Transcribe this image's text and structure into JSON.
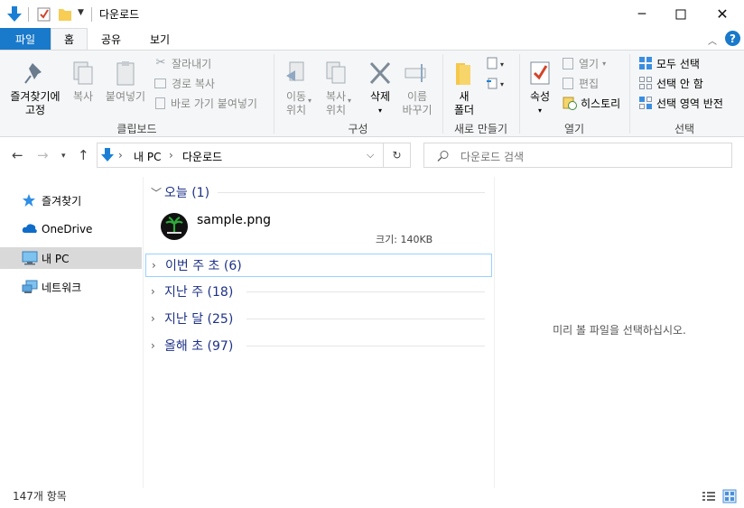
{
  "window": {
    "title": "다운로드"
  },
  "tabs": {
    "file": "파일",
    "home": "홈",
    "share": "공유",
    "view": "보기"
  },
  "ribbon": {
    "clipboard": {
      "pin": "즐겨찾기에\n고정",
      "copy": "복사",
      "paste": "붙여넣기",
      "cut": "잘라내기",
      "copy_path": "경로 복사",
      "paste_shortcut": "바로 가기 붙여넣기",
      "label": "클립보드"
    },
    "organize": {
      "move_to": "이동\n위치",
      "copy_to": "복사\n위치",
      "delete": "삭제",
      "rename": "이름\n바꾸기",
      "label": "구성"
    },
    "new": {
      "new_folder": "새\n폴더",
      "label": "새로 만들기"
    },
    "open": {
      "properties": "속성",
      "open": "열기",
      "edit": "편집",
      "history": "히스토리",
      "label": "열기"
    },
    "select": {
      "select_all": "모두 선택",
      "select_none": "선택 안 함",
      "invert": "선택 영역 반전",
      "label": "선택"
    }
  },
  "address": {
    "root": "내 PC",
    "current": "다운로드",
    "sep": "›"
  },
  "search": {
    "placeholder": "다운로드 검색"
  },
  "nav": {
    "quick_access": "즐겨찾기",
    "onedrive": "OneDrive",
    "this_pc": "내 PC",
    "network": "네트워크"
  },
  "groups": [
    {
      "label": "오늘 (1)",
      "expanded": true
    },
    {
      "label": "이번 주 초 (6)",
      "expanded": false
    },
    {
      "label": "지난 주 (18)",
      "expanded": false
    },
    {
      "label": "지난 달 (25)",
      "expanded": false
    },
    {
      "label": "올해 초 (97)",
      "expanded": false
    }
  ],
  "file": {
    "name": "sample.png",
    "size": "크기: 140KB"
  },
  "preview": {
    "message": "미리 볼 파일을 선택하십시오."
  },
  "status": {
    "count": "147개 항목"
  },
  "colors": {
    "accent": "#1979ca",
    "group_text": "#1e3287",
    "selected_bg": "#cce8ff"
  }
}
